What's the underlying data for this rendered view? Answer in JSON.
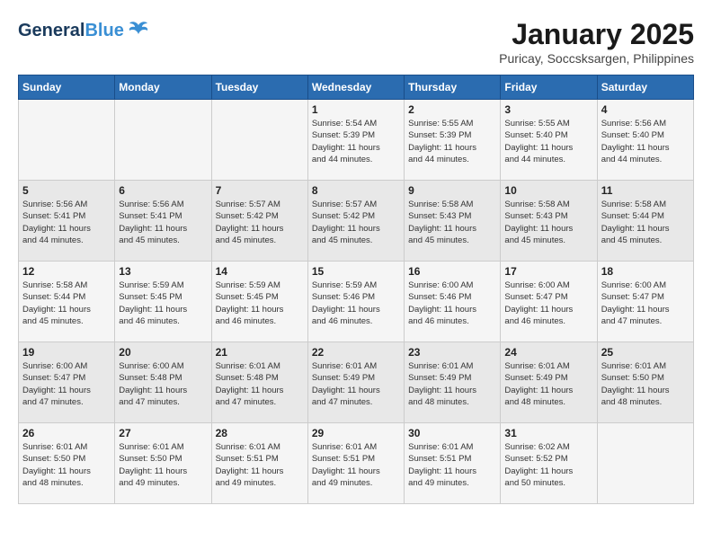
{
  "header": {
    "logo_general": "General",
    "logo_blue": "Blue",
    "month": "January 2025",
    "location": "Puricay, Soccsksargen, Philippines"
  },
  "days_of_week": [
    "Sunday",
    "Monday",
    "Tuesday",
    "Wednesday",
    "Thursday",
    "Friday",
    "Saturday"
  ],
  "weeks": [
    [
      {
        "day": "",
        "info": ""
      },
      {
        "day": "",
        "info": ""
      },
      {
        "day": "",
        "info": ""
      },
      {
        "day": "1",
        "info": "Sunrise: 5:54 AM\nSunset: 5:39 PM\nDaylight: 11 hours\nand 44 minutes."
      },
      {
        "day": "2",
        "info": "Sunrise: 5:55 AM\nSunset: 5:39 PM\nDaylight: 11 hours\nand 44 minutes."
      },
      {
        "day": "3",
        "info": "Sunrise: 5:55 AM\nSunset: 5:40 PM\nDaylight: 11 hours\nand 44 minutes."
      },
      {
        "day": "4",
        "info": "Sunrise: 5:56 AM\nSunset: 5:40 PM\nDaylight: 11 hours\nand 44 minutes."
      }
    ],
    [
      {
        "day": "5",
        "info": "Sunrise: 5:56 AM\nSunset: 5:41 PM\nDaylight: 11 hours\nand 44 minutes."
      },
      {
        "day": "6",
        "info": "Sunrise: 5:56 AM\nSunset: 5:41 PM\nDaylight: 11 hours\nand 45 minutes."
      },
      {
        "day": "7",
        "info": "Sunrise: 5:57 AM\nSunset: 5:42 PM\nDaylight: 11 hours\nand 45 minutes."
      },
      {
        "day": "8",
        "info": "Sunrise: 5:57 AM\nSunset: 5:42 PM\nDaylight: 11 hours\nand 45 minutes."
      },
      {
        "day": "9",
        "info": "Sunrise: 5:58 AM\nSunset: 5:43 PM\nDaylight: 11 hours\nand 45 minutes."
      },
      {
        "day": "10",
        "info": "Sunrise: 5:58 AM\nSunset: 5:43 PM\nDaylight: 11 hours\nand 45 minutes."
      },
      {
        "day": "11",
        "info": "Sunrise: 5:58 AM\nSunset: 5:44 PM\nDaylight: 11 hours\nand 45 minutes."
      }
    ],
    [
      {
        "day": "12",
        "info": "Sunrise: 5:58 AM\nSunset: 5:44 PM\nDaylight: 11 hours\nand 45 minutes."
      },
      {
        "day": "13",
        "info": "Sunrise: 5:59 AM\nSunset: 5:45 PM\nDaylight: 11 hours\nand 46 minutes."
      },
      {
        "day": "14",
        "info": "Sunrise: 5:59 AM\nSunset: 5:45 PM\nDaylight: 11 hours\nand 46 minutes."
      },
      {
        "day": "15",
        "info": "Sunrise: 5:59 AM\nSunset: 5:46 PM\nDaylight: 11 hours\nand 46 minutes."
      },
      {
        "day": "16",
        "info": "Sunrise: 6:00 AM\nSunset: 5:46 PM\nDaylight: 11 hours\nand 46 minutes."
      },
      {
        "day": "17",
        "info": "Sunrise: 6:00 AM\nSunset: 5:47 PM\nDaylight: 11 hours\nand 46 minutes."
      },
      {
        "day": "18",
        "info": "Sunrise: 6:00 AM\nSunset: 5:47 PM\nDaylight: 11 hours\nand 47 minutes."
      }
    ],
    [
      {
        "day": "19",
        "info": "Sunrise: 6:00 AM\nSunset: 5:47 PM\nDaylight: 11 hours\nand 47 minutes."
      },
      {
        "day": "20",
        "info": "Sunrise: 6:00 AM\nSunset: 5:48 PM\nDaylight: 11 hours\nand 47 minutes."
      },
      {
        "day": "21",
        "info": "Sunrise: 6:01 AM\nSunset: 5:48 PM\nDaylight: 11 hours\nand 47 minutes."
      },
      {
        "day": "22",
        "info": "Sunrise: 6:01 AM\nSunset: 5:49 PM\nDaylight: 11 hours\nand 47 minutes."
      },
      {
        "day": "23",
        "info": "Sunrise: 6:01 AM\nSunset: 5:49 PM\nDaylight: 11 hours\nand 48 minutes."
      },
      {
        "day": "24",
        "info": "Sunrise: 6:01 AM\nSunset: 5:49 PM\nDaylight: 11 hours\nand 48 minutes."
      },
      {
        "day": "25",
        "info": "Sunrise: 6:01 AM\nSunset: 5:50 PM\nDaylight: 11 hours\nand 48 minutes."
      }
    ],
    [
      {
        "day": "26",
        "info": "Sunrise: 6:01 AM\nSunset: 5:50 PM\nDaylight: 11 hours\nand 48 minutes."
      },
      {
        "day": "27",
        "info": "Sunrise: 6:01 AM\nSunset: 5:50 PM\nDaylight: 11 hours\nand 49 minutes."
      },
      {
        "day": "28",
        "info": "Sunrise: 6:01 AM\nSunset: 5:51 PM\nDaylight: 11 hours\nand 49 minutes."
      },
      {
        "day": "29",
        "info": "Sunrise: 6:01 AM\nSunset: 5:51 PM\nDaylight: 11 hours\nand 49 minutes."
      },
      {
        "day": "30",
        "info": "Sunrise: 6:01 AM\nSunset: 5:51 PM\nDaylight: 11 hours\nand 49 minutes."
      },
      {
        "day": "31",
        "info": "Sunrise: 6:02 AM\nSunset: 5:52 PM\nDaylight: 11 hours\nand 50 minutes."
      },
      {
        "day": "",
        "info": ""
      }
    ]
  ]
}
